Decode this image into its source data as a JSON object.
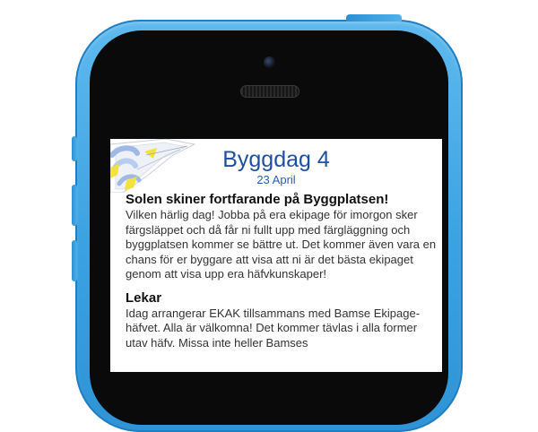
{
  "article": {
    "title": "Byggdag 4",
    "date": "23 April",
    "headline": "Solen skiner fortfarande på Byggplatsen!",
    "paragraph": "Vilken härlig dag! Jobba på era ekipage för imorgon sker färgsläppet och då får ni fullt upp med färgläggning och byggplatsen kommer se bättre ut. Det kommer även vara en chans för er byggare att visa att ni är det bästa ekipaget genom att visa upp era häfvkunskaper!",
    "section_heading": "Lekar",
    "section_paragraph": "Idag arrangerar EKAK tillsammans med Bamse Ekipage-häfvet. Alla är välkomna! Det kommer tävlas i alla former utav häfv. Missa inte heller Bamses"
  },
  "colors": {
    "phone_body": "#3aa2e2",
    "title": "#1f4f9f",
    "logo_accent": "#f2e23a"
  }
}
